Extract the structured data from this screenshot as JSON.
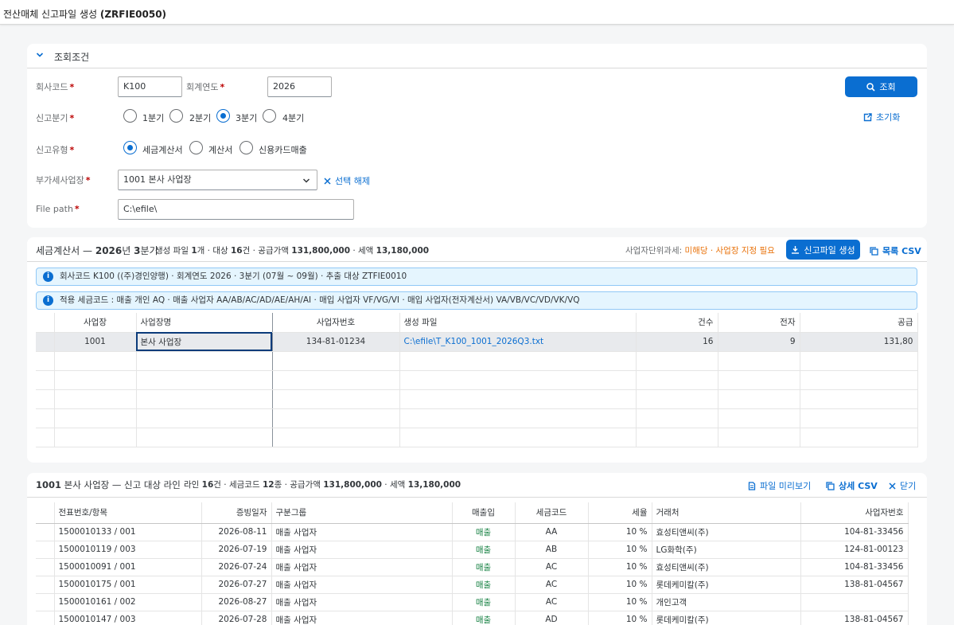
{
  "shell": {
    "title_prefix": "전산매체 신고파일 생성",
    "title_code": "(ZRFIE0050)"
  },
  "filter": {
    "section_title": "조회조건",
    "company_label": "회사코드",
    "company_value": "K100",
    "year_label": "회계연도",
    "year_value": "2026",
    "quarter_label": "신고분기",
    "quarters": [
      "1분기",
      "2분기",
      "3분기",
      "4분기"
    ],
    "quarter_selected": "3분기",
    "type_label": "신고유형",
    "types": [
      "세금계산서",
      "계산서",
      "신용카드매출"
    ],
    "type_selected": "세금계산서",
    "biz_label": "부가세사업장",
    "biz_value": "1001 본사 사업장",
    "clear_label": "선택 해제",
    "path_label": "File path",
    "path_value": "C:\\efile\\",
    "search_label": "조회",
    "reset_label": "초기화"
  },
  "summary": {
    "title": "세금계산서 — 2026년 3분기",
    "title_a": "세금계산서 — ",
    "title_year": "2026",
    "title_b": "년 ",
    "title_q": "3",
    "title_c": "분기",
    "stats_a": "생성 파일 ",
    "files": "1",
    "stats_b": "개 · 대상 ",
    "count": "16",
    "stats_c": "건 · 공급가액 ",
    "supply": "131,800,000",
    "stats_d": " · 세액 ",
    "tax": "13,180,000",
    "unit_tax_label": "사업자단위과세:",
    "unit_tax_value": "미해당 · 사업장 지정 필요",
    "generate_label": "신고파일 생성",
    "csv_label": "목록 CSV",
    "msg1": "회사코드 K100 ((주)경인양행) · 회계연도 2026 · 3분기 (07월 ~ 09월) · 추출 대상 ZTFIE0010",
    "msg2": "적용 세금코드 : 매출 개인 AQ · 매출 사업자 AA/AB/AC/AD/AE/AH/AI · 매입 사업자 VF/VG/VI · 매입 사업자(전자계산서) VA/VB/VC/VD/VK/VQ",
    "columns": [
      "사업장",
      "사업장명",
      "사업자번호",
      "생성 파일",
      "건수",
      "전자",
      "공급"
    ],
    "rows": [
      {
        "biz": "1001",
        "name": "본사 사업장",
        "regno": "134-81-01234",
        "file": "C:\\efile\\T_K100_1001_2026Q3.txt",
        "count": "16",
        "elec": "9",
        "supply": "131,80"
      }
    ]
  },
  "detail": {
    "title_a": "1001",
    "title_b": " 본사 사업장 — 신고 대상 라인",
    "stats_a": "라인 ",
    "lines": "16",
    "stats_b": "건 · 세금코드 ",
    "codes": "12",
    "stats_c": "종 · 공급가액 ",
    "supply": "131,800,000",
    "stats_d": " · 세액 ",
    "tax": "13,180,000",
    "preview_label": "파일 미리보기",
    "csv_label": "상세 CSV",
    "close_label": "닫기",
    "columns": [
      "전표번호/항목",
      "증빙일자",
      "구분그룹",
      "매출입",
      "세금코드",
      "세율",
      "거래처",
      "사업자번호"
    ],
    "rows": [
      {
        "doc": "1500010133 / 001",
        "date": "2026-08-11",
        "group": "매출 사업자",
        "io": "매출",
        "code": "AA",
        "rate": "10 %",
        "partner": "효성티앤씨(주)",
        "regno": "104-81-33456"
      },
      {
        "doc": "1500010119 / 003",
        "date": "2026-07-19",
        "group": "매출 사업자",
        "io": "매출",
        "code": "AB",
        "rate": "10 %",
        "partner": "LG화학(주)",
        "regno": "124-81-00123"
      },
      {
        "doc": "1500010091 / 001",
        "date": "2026-07-24",
        "group": "매출 사업자",
        "io": "매출",
        "code": "AC",
        "rate": "10 %",
        "partner": "효성티앤씨(주)",
        "regno": "104-81-33456"
      },
      {
        "doc": "1500010175 / 001",
        "date": "2026-07-27",
        "group": "매출 사업자",
        "io": "매출",
        "code": "AC",
        "rate": "10 %",
        "partner": "롯데케미칼(주)",
        "regno": "138-81-04567"
      },
      {
        "doc": "1500010161 / 002",
        "date": "2026-08-27",
        "group": "매출 사업자",
        "io": "매출",
        "code": "AC",
        "rate": "10 %",
        "partner": "개인고객",
        "regno": ""
      },
      {
        "doc": "1500010147 / 003",
        "date": "2026-07-28",
        "group": "매출 사업자",
        "io": "매출",
        "code": "AD",
        "rate": "10 %",
        "partner": "롯데케미칼(주)",
        "regno": "138-81-04567"
      }
    ]
  }
}
